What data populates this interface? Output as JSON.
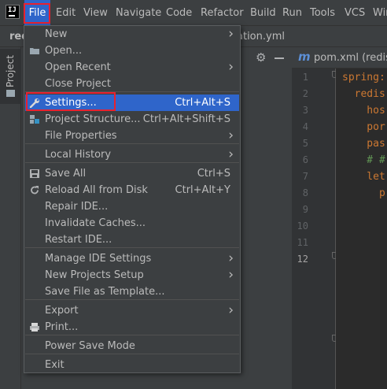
{
  "menubar": {
    "items": [
      "File",
      "Edit",
      "View",
      "Navigate",
      "Code",
      "Refactor",
      "Build",
      "Run",
      "Tools",
      "VCS",
      "Win"
    ]
  },
  "tabrow": {
    "left_tab": "red",
    "file_tab": "ation.yml"
  },
  "toolstrip": {
    "project_label": "Project"
  },
  "editor": {
    "tab_label": "pom.xml (redis-",
    "line_numbers": [
      "1",
      "2",
      "3",
      "4",
      "5",
      "6",
      "7",
      "8",
      "9",
      "10",
      "11",
      "12"
    ],
    "current_line": "12",
    "code": [
      {
        "text": "spring:",
        "cls": "key"
      },
      {
        "text": "  redis",
        "cls": "key"
      },
      {
        "text": "    hos",
        "cls": "key"
      },
      {
        "text": "    por",
        "cls": "key"
      },
      {
        "text": "    pas",
        "cls": "key"
      },
      {
        "text": "    # #",
        "cls": "cmt"
      },
      {
        "text": "    let",
        "cls": "key"
      },
      {
        "text": "      p",
        "cls": "key"
      }
    ]
  },
  "file_menu": {
    "items": [
      {
        "label": "New",
        "shortcut": "",
        "submenu": true,
        "icon": ""
      },
      {
        "label": "Open...",
        "shortcut": "",
        "submenu": false,
        "icon": "folder-icon"
      },
      {
        "label": "Open Recent",
        "shortcut": "",
        "submenu": true,
        "icon": ""
      },
      {
        "label": "Close Project",
        "shortcut": "",
        "submenu": false,
        "icon": ""
      },
      {
        "label": "Settings...",
        "shortcut": "Ctrl+Alt+S",
        "submenu": false,
        "icon": "wrench-icon",
        "selected": true
      },
      {
        "label": "Project Structure...",
        "shortcut": "Ctrl+Alt+Shift+S",
        "submenu": false,
        "icon": "project-structure-icon"
      },
      {
        "label": "File Properties",
        "shortcut": "",
        "submenu": true,
        "icon": ""
      },
      {
        "label": "Local History",
        "shortcut": "",
        "submenu": true,
        "icon": ""
      },
      {
        "label": "Save All",
        "shortcut": "Ctrl+S",
        "submenu": false,
        "icon": "save-icon"
      },
      {
        "label": "Reload All from Disk",
        "shortcut": "Ctrl+Alt+Y",
        "submenu": false,
        "icon": "reload-icon"
      },
      {
        "label": "Repair IDE...",
        "shortcut": "",
        "submenu": false,
        "icon": ""
      },
      {
        "label": "Invalidate Caches...",
        "shortcut": "",
        "submenu": false,
        "icon": ""
      },
      {
        "label": "Restart IDE...",
        "shortcut": "",
        "submenu": false,
        "icon": ""
      },
      {
        "label": "Manage IDE Settings",
        "shortcut": "",
        "submenu": true,
        "icon": ""
      },
      {
        "label": "New Projects Setup",
        "shortcut": "",
        "submenu": true,
        "icon": ""
      },
      {
        "label": "Save File as Template...",
        "shortcut": "",
        "submenu": false,
        "icon": ""
      },
      {
        "label": "Export",
        "shortcut": "",
        "submenu": true,
        "icon": ""
      },
      {
        "label": "Print...",
        "shortcut": "",
        "submenu": false,
        "icon": "print-icon"
      },
      {
        "label": "Power Save Mode",
        "shortcut": "",
        "submenu": false,
        "icon": ""
      },
      {
        "label": "Exit",
        "shortcut": "",
        "submenu": false,
        "icon": ""
      }
    ]
  },
  "colors": {
    "selection": "#2f65ca",
    "highlight_box": "#e8212f",
    "menu_bg": "#3c3f41",
    "editor_bg": "#2b2b2b"
  }
}
